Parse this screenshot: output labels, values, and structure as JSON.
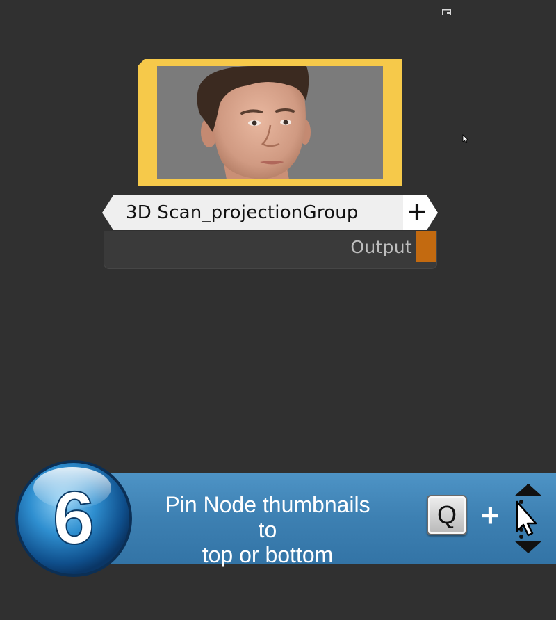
{
  "node": {
    "title": "3D Scan_projectionGroup",
    "add_label": "+",
    "output_label": "Output",
    "frame_color": "#f6c94a",
    "port_color": "#c36a10"
  },
  "tip": {
    "number": "6",
    "text_line1": "Pin Node thumbnails to",
    "text_line2": "top or bottom",
    "key": "Q",
    "plus": "+",
    "drag_icon": "vertical-drag-cursor-icon",
    "banner_color": "#3d80b2"
  },
  "icons": {
    "window": "window-icon",
    "cursor": "mouse-cursor-icon"
  }
}
